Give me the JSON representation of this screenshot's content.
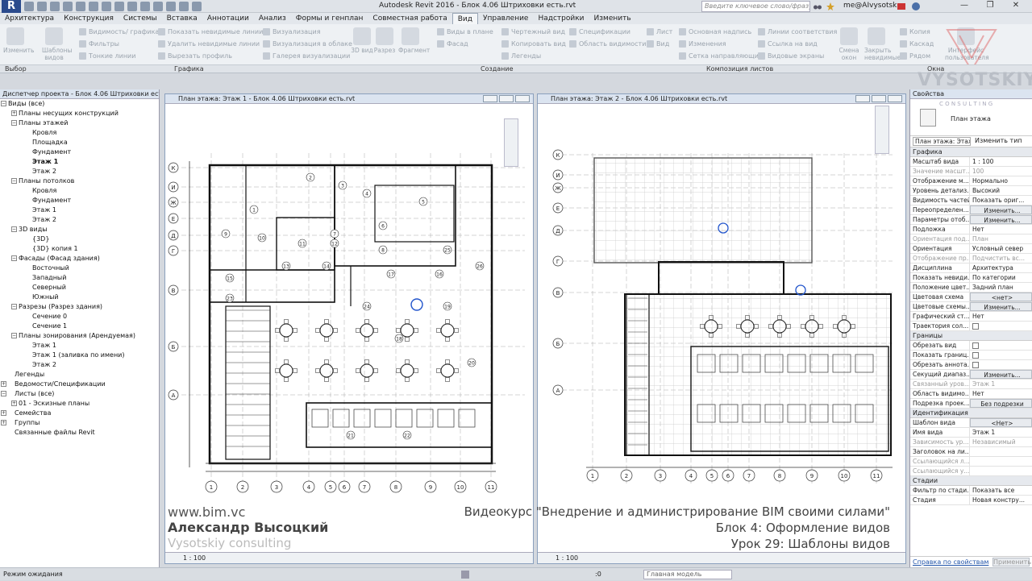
{
  "window": {
    "title": "Autodesk Revit 2016 -    Блок 4.06 Штриховки есть.rvt",
    "search_placeholder": "Введите ключевое слово/фразу",
    "user": "me@AIvysotsk...",
    "min": "—",
    "max": "❐",
    "close": "✕"
  },
  "app_logo": "R",
  "tabs": [
    "Архитектура",
    "Конструкция",
    "Системы",
    "Вставка",
    "Аннотации",
    "Анализ",
    "Формы и генплан",
    "Совместная работа",
    "Вид",
    "Управление",
    "Надстройки",
    "Изменить"
  ],
  "ribbon": {
    "modify": [
      "Изменить"
    ],
    "templates": [
      "Шаблоны",
      "видов"
    ],
    "graphics_items": [
      "Видимость/ графика",
      "Фильтры",
      "Тонкие линии",
      "Показать невидимые линии",
      "Удалить невидимые линии",
      "Вырезать профиль",
      "Визуализация",
      "Визуализация в облаке",
      "Галерея визуализации"
    ],
    "create_items": [
      "3D вид",
      "Разрез",
      "Фрагмент",
      "Виды в плане",
      "Фасад",
      "Чертежный вид",
      "Копировать вид",
      "Легенды",
      "Спецификации",
      "Область видимости"
    ],
    "sheet_items": [
      "Лист",
      "Вид",
      "Основная надпись",
      "Изменения",
      "Сетка направляющих",
      "Линии соответствия",
      "Ссылка на вид",
      "Видовые экраны"
    ],
    "window_items": [
      "Смена окон",
      "Закрыть невидимые",
      "Копия",
      "Каскад",
      "Рядом",
      "Интерфейс пользователя"
    ],
    "panels": [
      "Выбор",
      "Графика",
      "Создание",
      "Композиция листов",
      "Окна"
    ]
  },
  "project_browser": {
    "title": "Диспетчер проекта - Блок 4.06 Штриховки есть.rvt",
    "items": [
      "Виды (все)",
      "Планы несущих конструкций",
      "Планы этажей",
      "Кровля",
      "Площадка",
      "Фундамент",
      "Этаж 1",
      "Этаж 2",
      "Планы потолков",
      "Кровля",
      "Фундамент",
      "Этаж 1",
      "Этаж 2",
      "3D виды",
      "{3D}",
      "{3D} копия 1",
      "Фасады (Фасад здания)",
      "Восточный",
      "Западный",
      "Северный",
      "Южный",
      "Разрезы (Разрез здания)",
      "Сечение 0",
      "Сечение 1",
      "Планы зонирования (Арендуемая)",
      "Этаж 1",
      "Этаж 1 (заливка по имени)",
      "Этаж 2",
      "Легенды",
      "Ведомости/Спецификации",
      "Листы (все)",
      "01 - Эскизные планы",
      "Семейства",
      "Группы",
      "Связанные файлы Revit"
    ]
  },
  "view1": {
    "title": "План этажа: Этаж 1 - Блок 4.06 Штриховки есть.rvt",
    "scale": "1 : 100",
    "grid_rows": [
      "К",
      "И",
      "Ж",
      "Е",
      "Д",
      "Г",
      "В",
      "Б",
      "А"
    ],
    "grid_cols": [
      "1",
      "2",
      "3",
      "4",
      "5",
      "6",
      "7",
      "8",
      "9",
      "10",
      "11"
    ],
    "rooms": [
      "1",
      "2",
      "3",
      "4",
      "5",
      "6",
      "7",
      "8",
      "9",
      "10",
      "11",
      "12",
      "13",
      "14",
      "15",
      "16",
      "17",
      "18",
      "19",
      "20",
      "21",
      "22",
      "23",
      "24",
      "25",
      "26"
    ]
  },
  "view2": {
    "title": "План этажа: Этаж 2 - Блок 4.06 Штриховки есть.rvt",
    "scale": "1 : 100",
    "grid_rows": [
      "К",
      "И",
      "Ж",
      "Е",
      "Д",
      "Г",
      "В",
      "Б",
      "А"
    ],
    "grid_cols": [
      "1",
      "2",
      "3",
      "4",
      "5",
      "6",
      "7",
      "8",
      "9",
      "10",
      "11"
    ]
  },
  "properties": {
    "title": "Свойства",
    "type_name": "План этажа",
    "filter": "План этажа: Этаж",
    "edit_type": "Изменить тип",
    "groups": [
      {
        "name": "Графика",
        "rows": [
          [
            "Масштаб вида",
            "1 : 100"
          ],
          [
            "Значение масшт...",
            "100"
          ],
          [
            "Отображение м...",
            "Нормально"
          ],
          [
            "Уровень детализ...",
            "Высокий"
          ],
          [
            "Видимость частей",
            "Показать ориг..."
          ],
          [
            "Переопределен...",
            "Изменить..."
          ],
          [
            "Параметры отоб...",
            "Изменить..."
          ],
          [
            "Подложка",
            "Нет"
          ],
          [
            "Ориентация под...",
            "План"
          ],
          [
            "Ориентация",
            "Условный север"
          ],
          [
            "Отображение пр...",
            "Подчистить вс..."
          ],
          [
            "Дисциплина",
            "Архитектура"
          ],
          [
            "Показать невиди...",
            "По категории"
          ],
          [
            "Положение цвет...",
            "Задний план"
          ],
          [
            "Цветовая схема",
            "<нет>"
          ],
          [
            "Цветовые схемы...",
            "Изменить..."
          ],
          [
            "Графический ст...",
            "Нет"
          ],
          [
            "Траектория сол...",
            ""
          ]
        ]
      },
      {
        "name": "Границы",
        "rows": [
          [
            "Обрезать вид",
            ""
          ],
          [
            "Показать границ...",
            ""
          ],
          [
            "Обрезать аннота...",
            ""
          ],
          [
            "Секущий диапаз...",
            "Изменить..."
          ],
          [
            "Связанный уров...",
            "Этаж 1"
          ],
          [
            "Область видимо...",
            "Нет"
          ],
          [
            "Подрезка проек...",
            "Без подрезки"
          ]
        ]
      },
      {
        "name": "Идентификация",
        "rows": [
          [
            "Шаблон вида",
            "<Нет>"
          ],
          [
            "Имя вида",
            "Этаж 1"
          ],
          [
            "Зависимость ур...",
            "Независимый"
          ],
          [
            "Заголовок на ли...",
            ""
          ],
          [
            "Ссылающийся л...",
            ""
          ],
          [
            "Ссылающийся у...",
            ""
          ]
        ]
      },
      {
        "name": "Стадии",
        "rows": [
          [
            "Фильтр по стади...",
            "Показать все"
          ],
          [
            "Стадия",
            "Новая констру..."
          ]
        ]
      }
    ],
    "help_link": "Справка по свойствам",
    "apply": "Применить"
  },
  "status": {
    "text": "Режим ожидания",
    "zero": ":0",
    "model": "Главная модель"
  },
  "overlay": {
    "site": "www.bim.vc",
    "author": "Александр Высоцкий",
    "company": "Vysotskiy consulting",
    "course": "Видеокурс \"Внедрение и администрирование BIM своими силами\"",
    "block": "Блок 4: Оформление видов",
    "lesson": "Урок 29: Шаблоны видов",
    "logo_main": "VYSOTSKIY",
    "logo_sub": "C O N S U L T I N G"
  }
}
